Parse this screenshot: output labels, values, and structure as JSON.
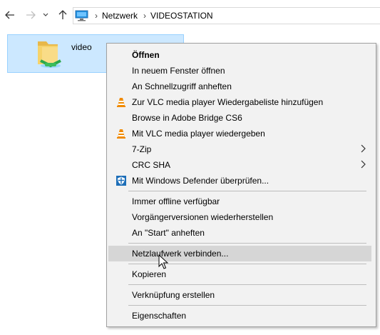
{
  "nav": {
    "breadcrumb": [
      "Netzwerk",
      "VIDEOSTATION"
    ]
  },
  "folder": {
    "name": "video"
  },
  "menu": {
    "items": [
      {
        "label": "Öffnen",
        "icon": "none"
      },
      {
        "label": "In neuem Fenster öffnen",
        "icon": "none"
      },
      {
        "label": "An Schnellzugriff anheften",
        "icon": "none"
      },
      {
        "label": "Zur VLC media player Wiedergabeliste hinzufügen",
        "icon": "vlc-icon"
      },
      {
        "label": "Browse in Adobe Bridge CS6",
        "icon": "none"
      },
      {
        "label": "Mit VLC media player wiedergeben",
        "icon": "vlc-icon"
      },
      {
        "label": "7-Zip",
        "icon": "none"
      },
      {
        "label": "CRC SHA",
        "icon": "none"
      },
      {
        "label": "Mit Windows Defender überprüfen...",
        "icon": "defender-icon"
      },
      {
        "label": "Immer offline verfügbar",
        "icon": "none"
      },
      {
        "label": "Vorgängerversionen wiederherstellen",
        "icon": "none"
      },
      {
        "label": "An \"Start\" anheften",
        "icon": "none"
      },
      {
        "label": "Netzlaufwerk verbinden...",
        "icon": "none"
      },
      {
        "label": "Kopieren",
        "icon": "none"
      },
      {
        "label": "Verknüpfung erstellen",
        "icon": "none"
      },
      {
        "label": "Eigenschaften",
        "icon": "none"
      }
    ]
  },
  "colors": {
    "selection_bg": "#cce8ff",
    "selection_border": "#99d1ff",
    "menu_bg": "#f2f2f2",
    "menu_highlight": "#d6d6d6"
  }
}
